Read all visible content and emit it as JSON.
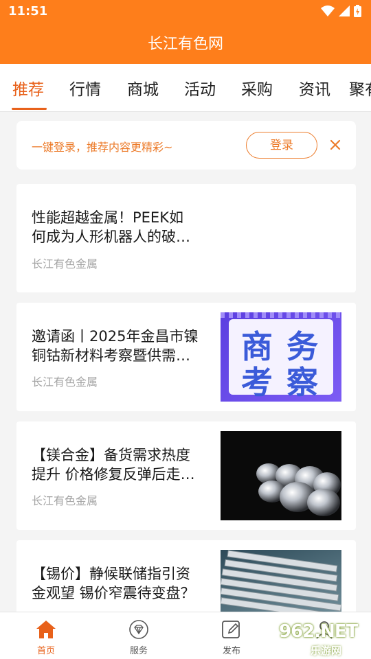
{
  "status_bar": {
    "time": "11:51"
  },
  "header": {
    "title": "长江有色网"
  },
  "tabs": [
    {
      "label": "推荐",
      "active": true
    },
    {
      "label": "行情"
    },
    {
      "label": "商城"
    },
    {
      "label": "活动"
    },
    {
      "label": "采购"
    },
    {
      "label": "资讯"
    },
    {
      "label": "聚有"
    }
  ],
  "login_banner": {
    "text": "一键登录，推荐内容更精彩~",
    "button_label": "登录",
    "close_icon": "close-icon"
  },
  "articles": [
    {
      "title_line1": "性能超越金属！PEEK如",
      "title_line2": "何成为人形机器人的破…",
      "source": "长江有色金属"
    },
    {
      "title_line1": "邀请函丨2025年金昌市镍",
      "title_line2": "铜钴新材料考察暨供需…",
      "source": "长江有色金属",
      "thumb": {
        "chars": [
          "商",
          "务",
          "考",
          "察"
        ]
      }
    },
    {
      "title_line1": "【镁合金】备货需求热度",
      "title_line2": "提升 价格修复反弹后走…",
      "source": "长江有色金属"
    },
    {
      "title_line1": "【锡价】静候联储指引资",
      "title_line2": "金观望 锡价窄震待变盘？",
      "source": ""
    }
  ],
  "bottom_nav": [
    {
      "label": "首页",
      "icon": "home-icon",
      "active": true
    },
    {
      "label": "服务",
      "icon": "diamond-icon"
    },
    {
      "label": "发布",
      "icon": "edit-icon"
    },
    {
      "label": "",
      "icon": "user-icon"
    }
  ],
  "watermark": {
    "text": "962.NET",
    "sub": "乐游网"
  },
  "colors": {
    "brand": "#fe7e1b",
    "accent": "#e8611a"
  }
}
